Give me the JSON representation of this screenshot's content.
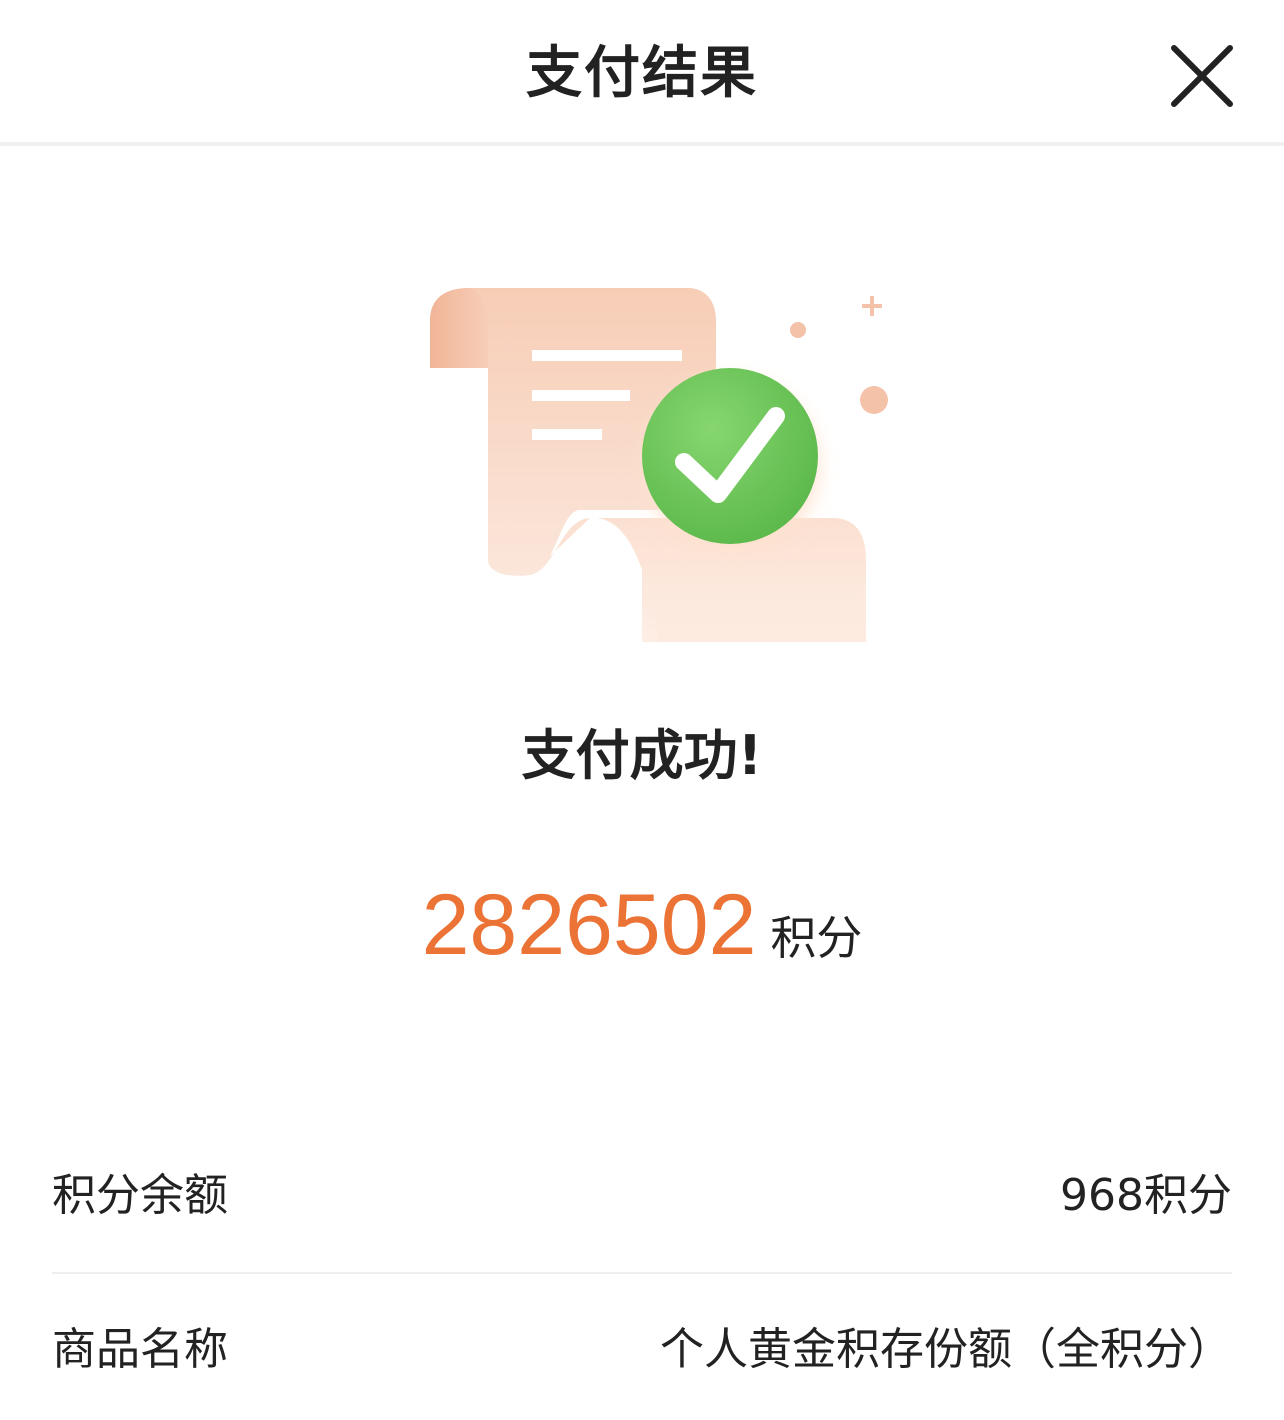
{
  "header": {
    "title": "支付结果",
    "close_icon": "close-icon"
  },
  "result": {
    "illustration": "receipt-success-icon",
    "status_text": "支付成功!",
    "amount": "2826502",
    "amount_unit": "积分"
  },
  "details": [
    {
      "label": "积分余额",
      "value": "968积分"
    },
    {
      "label": "商品名称",
      "value": "个人黄金积存份额（全积分）"
    }
  ],
  "colors": {
    "accent": "#ec7336",
    "success_green": "#6cc45a",
    "paper": "#f8d9c8"
  }
}
